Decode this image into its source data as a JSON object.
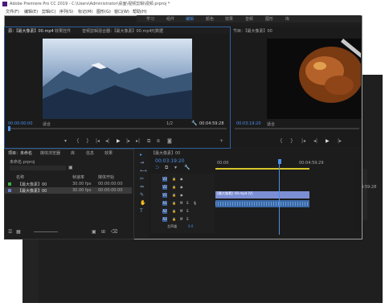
{
  "app": {
    "title_bar": "Adobe Premiere Pro CC 2019 - C:\\Users\\Administrator\\桌面\\视频剪辑\\视频.prproj *"
  },
  "menu": [
    "文件(F)",
    "编辑(E)",
    "剪辑(C)",
    "序列(S)",
    "标记(M)",
    "图形(G)",
    "窗口(W)",
    "帮助(H)"
  ],
  "workspaces": {
    "tabs": [
      "学习",
      "组件",
      "编辑",
      "颜色",
      "效果",
      "音频",
      "图形",
      "库"
    ],
    "active": "编辑"
  },
  "source_panel": {
    "tabs": [
      "源：【最大像素】00.mp4",
      "效果控件",
      "音频剪辑混合器：【最大像素】00.mp4",
      "元数据"
    ],
    "timecode_left": "00:00:00:00",
    "fit": "适合",
    "page": "1/2",
    "timecode_right": "00:04:59:28"
  },
  "program_panel": {
    "title": "节目：【最大像素】00",
    "timecode": "00:03:19:20",
    "fit": "适合"
  },
  "project_panel": {
    "tabs": [
      "项目：未命名",
      "媒体浏览器",
      "库",
      "信息",
      "效果"
    ],
    "project_file": "未命名.prproj",
    "columns": [
      "名称",
      "帧速率",
      "媒体开始"
    ],
    "items": [
      {
        "name": "【最大像素】00",
        "fps": "30.00 fps",
        "start": "00:00:00:00",
        "color": "#3fae49"
      },
      {
        "name": "【最大像素】00",
        "fps": "30.00 fps",
        "start": "00:00:00:00",
        "color": "#6f7fd0"
      }
    ]
  },
  "timeline": {
    "tab": "【最大像素】00",
    "timecode": "00:03:19:20",
    "ruler": [
      "00:00",
      "00:04:59:29"
    ],
    "tracks": [
      "V3",
      "V2",
      "V1",
      "A1",
      "A2",
      "A3"
    ],
    "video_clip": "【最大像素】00.mp4 [V]",
    "audio_track_label": "主声道",
    "audio_level": "0.0"
  },
  "background_window": {
    "clip_label": "【最大像素】00.mp4 [V]",
    "timecode_right": "4:59:28"
  }
}
